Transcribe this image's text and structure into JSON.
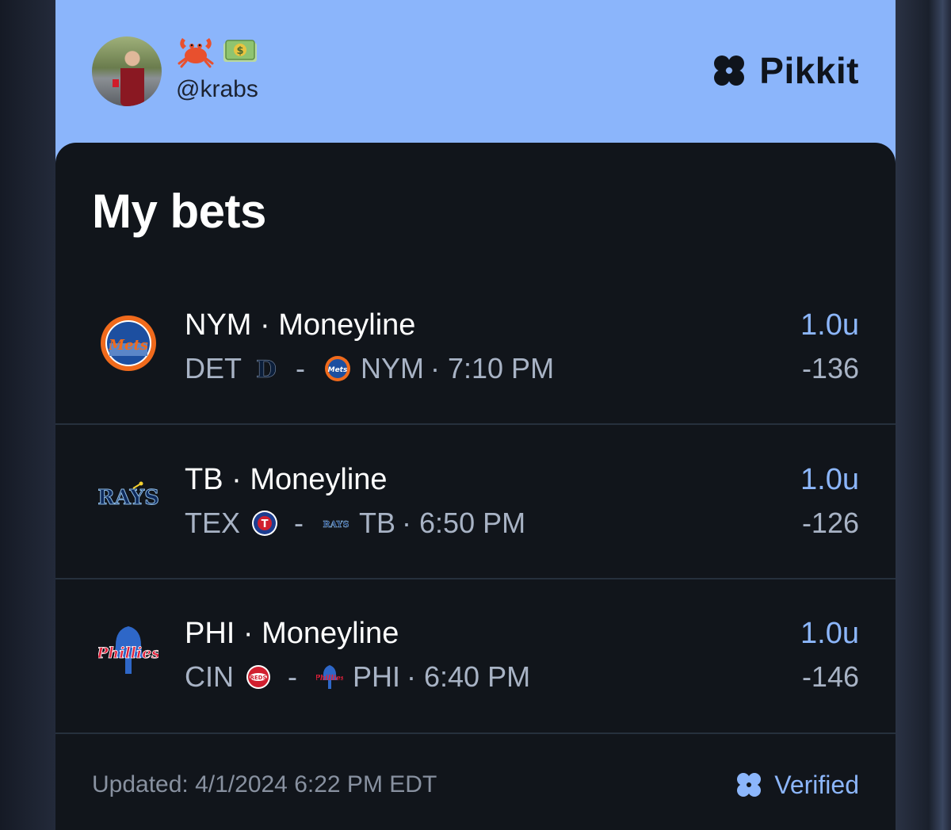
{
  "header": {
    "emojis": [
      "crab",
      "money-bag-bill"
    ],
    "handle": "@krabs",
    "brand": "Pikkit"
  },
  "panel": {
    "title": "My bets"
  },
  "bets": [
    {
      "title": "NYM · Moneyline",
      "away": "DET",
      "home": "NYM",
      "separator": "-",
      "time": "· 7:10 PM",
      "units": "1.0u",
      "odds": "-136",
      "logo": "mets-logo-icon"
    },
    {
      "title": "TB · Moneyline",
      "away": "TEX",
      "home": "TB",
      "separator": "-",
      "time": "· 6:50 PM",
      "units": "1.0u",
      "odds": "-126",
      "logo": "rays-logo-icon"
    },
    {
      "title": "PHI · Moneyline",
      "away": "CIN",
      "home": "PHI",
      "separator": "-",
      "time": "· 6:40 PM",
      "units": "1.0u",
      "odds": "-146",
      "logo": "phillies-logo-icon"
    }
  ],
  "footer": {
    "updated": "Updated: 4/1/2024 6:22 PM EDT",
    "verified": "Verified"
  },
  "colors": {
    "header_bg": "#8bb5fb",
    "panel_bg": "#11151b",
    "accent": "#8cb6fb",
    "muted_text": "#a8b3c5"
  }
}
